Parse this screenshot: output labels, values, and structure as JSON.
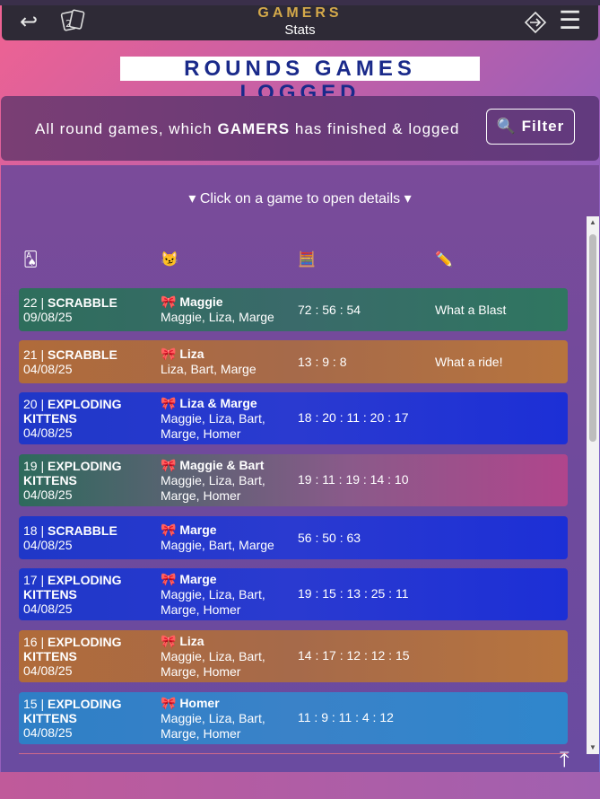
{
  "header": {
    "brand": "GAMERS",
    "subtitle": "Stats",
    "back_icon": "back-arrow-icon",
    "cards_icon": "playing-cards-icon",
    "signin_icon": "sign-in-icon",
    "menu_icon": "hamburger-menu-icon"
  },
  "hero": {
    "title": "ROUNDS GAMES LOGGED"
  },
  "info": {
    "prefix": "All round games, which",
    "group": "GAMERS",
    "suffix": "has finished & logged",
    "filter_label": "🔍 Filter"
  },
  "hint": "Click on a game to open details",
  "columns": {
    "game_icon": "🂡",
    "winners_icon": "😼",
    "scores_icon": "🧮",
    "notes_icon": "✏️"
  },
  "rows": [
    {
      "num": "22 |",
      "game": "SCRABBLE",
      "date": "09/08/25",
      "winner": "🎀 Maggie",
      "players": "Maggie, Liza, Marge",
      "scores": "72 : 56 : 54",
      "note": "What a Blast"
    },
    {
      "num": "21 |",
      "game": "SCRABBLE",
      "date": "04/08/25",
      "winner": "🎀 Liza",
      "players": "Liza, Bart, Marge",
      "scores": "13 : 9 : 8",
      "note": "What a ride!"
    },
    {
      "num": "20 |",
      "game": "EXPLODING",
      "game2": "KITTENS",
      "date": "04/08/25",
      "winner": "🎀 Liza & Marge",
      "players": "Maggie, Liza, Bart,",
      "players2": "Marge, Homer",
      "scores": "18 : 20 : 11 : 20 : 17",
      "note": ""
    },
    {
      "num": "19 |",
      "game": "EXPLODING",
      "game2": "KITTENS",
      "date": "04/08/25",
      "winner": "🎀 Maggie & Bart",
      "players": "Maggie, Liza, Bart,",
      "players2": "Marge, Homer",
      "scores": "19 : 11 : 19 : 14 : 10",
      "note": ""
    },
    {
      "num": "18 |",
      "game": "SCRABBLE",
      "date": "04/08/25",
      "winner": "🎀 Marge",
      "players": "Maggie, Bart, Marge",
      "scores": "56 : 50 : 63",
      "note": ""
    },
    {
      "num": "17 |",
      "game": "EXPLODING",
      "game2": "KITTENS",
      "date": "04/08/25",
      "winner": "🎀 Marge",
      "players": "Maggie, Liza, Bart,",
      "players2": "Marge, Homer",
      "scores": "19 : 15 : 13 : 25 : 11",
      "note": ""
    },
    {
      "num": "16 |",
      "game": "EXPLODING",
      "game2": "KITTENS",
      "date": "04/08/25",
      "winner": "🎀 Liza",
      "players": "Maggie, Liza, Bart,",
      "players2": "Marge, Homer",
      "scores": "14 : 17 : 12 : 12 : 15",
      "note": ""
    },
    {
      "num": "15 |",
      "game": "EXPLODING",
      "game2": "KITTENS",
      "date": "04/08/25",
      "winner": "🎀 Homer",
      "players": "Maggie, Liza, Bart,",
      "players2": "Marge, Homer",
      "scores": "11 : 9 : 11 : 4 : 12",
      "note": ""
    }
  ]
}
